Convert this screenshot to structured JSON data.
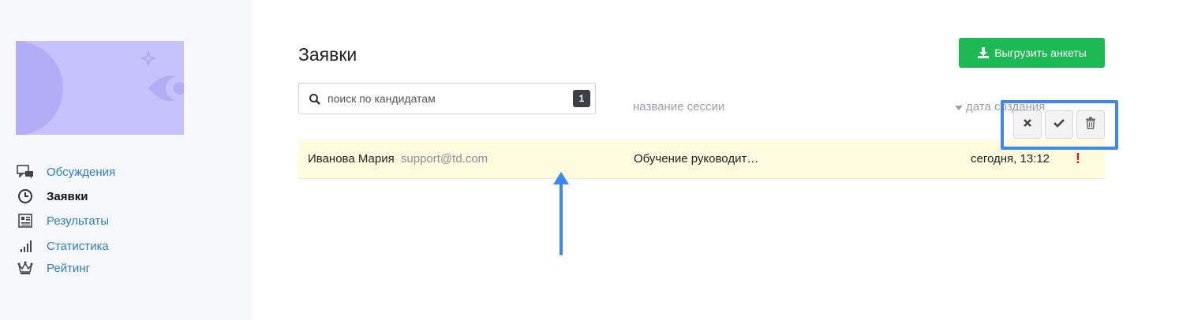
{
  "sidebar": {
    "items": [
      {
        "label": "Обсуждения",
        "icon": "chat-bubbles-icon",
        "active": false
      },
      {
        "label": "Заявки",
        "icon": "clock-icon",
        "active": true
      },
      {
        "label": "Результаты",
        "icon": "results-table-icon",
        "active": false
      },
      {
        "label": "Статистика",
        "icon": "bar-chart-icon",
        "active": false
      },
      {
        "label": "Рейтинг",
        "icon": "crown-icon",
        "active": false
      }
    ]
  },
  "main": {
    "title": "Заявки",
    "export_label": "Выгрузить анкеты",
    "search": {
      "placeholder": "поиск по кандидатам",
      "value": "",
      "count": "1"
    },
    "columns": {
      "session": "название сессии",
      "date": "дата создания"
    },
    "rows": [
      {
        "name": "Иванова Мария",
        "email": "support@td.com",
        "session": "Обучение руководит…",
        "date": "сегодня, 13:12",
        "alert": "!"
      }
    ]
  },
  "colors": {
    "accent_green": "#1db954",
    "link_blue": "#2a7fc8",
    "highlight_blue": "#3c88f0",
    "row_bg": "#fefbdf",
    "alert_red": "#e01b1b"
  }
}
